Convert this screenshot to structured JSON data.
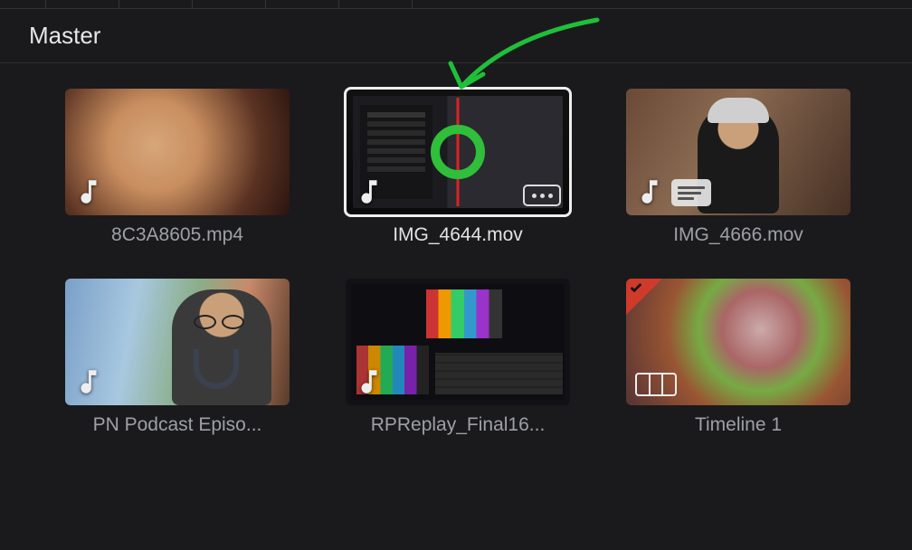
{
  "bin": {
    "title": "Master"
  },
  "clips": [
    {
      "label": "8C3A8605.mp4"
    },
    {
      "label": "IMG_4644.mov"
    },
    {
      "label": "IMG_4666.mov"
    },
    {
      "label": "PN Podcast Episo..."
    },
    {
      "label": "RPReplay_Final16..."
    },
    {
      "label": "Timeline 1"
    }
  ]
}
